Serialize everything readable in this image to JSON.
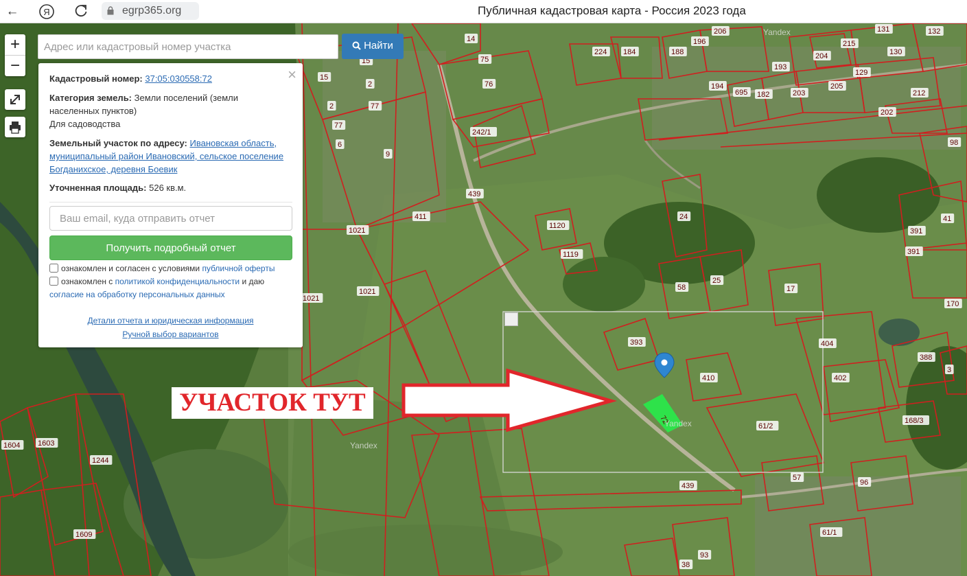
{
  "browser": {
    "url": "egrp365.org",
    "page_title": "Публичная кадастровая карта - Россия 2023 года",
    "icons": [
      "back-icon",
      "yandex-icon",
      "reload-icon",
      "lock-icon"
    ]
  },
  "map_controls": {
    "zoom_in": "+",
    "zoom_out": "−"
  },
  "search": {
    "placeholder": "Адрес или кадастровый номер участка",
    "button_label": "Найти"
  },
  "info_panel": {
    "cadastral_label": "Кадастровый номер:",
    "cadastral_value": "37:05:030558:72",
    "category_label": "Категория земель:",
    "category_value": "Земли поселений (земли населенных пунктов)",
    "usage": "Для садоводства",
    "address_label": "Земельный участок по адресу:",
    "address_value": "Ивановская область, муниципальный район Ивановский, сельское поселение Богданихское, деревня Боевик",
    "area_label": "Уточненная площадь:",
    "area_value": "526 кв.м.",
    "email_placeholder": "Ваш email, куда отправить отчет",
    "report_button": "Получить подробный отчет",
    "consent1_text": "ознакомлен и согласен с условиями",
    "consent1_link": "публичной оферты",
    "consent2_text1": "ознакомлен с",
    "consent2_link1": "политикой конфиденциальности",
    "consent2_text2": "и даю",
    "consent2_link2": "согласие на обработку персональных данных",
    "details_link": "Детали отчета и юридическая информация",
    "manual_link": "Ручной выбор вариантов",
    "close": "×"
  },
  "annotation": {
    "label": "УЧАСТОК ТУТ"
  },
  "watermarks": [
    "Yandex",
    "Yandex",
    "Yandex"
  ],
  "plot_labels": [
    "14",
    "75",
    "76",
    "15",
    "2",
    "77",
    "2",
    "77",
    "6",
    "9",
    "15",
    "242/1",
    "439",
    "411",
    "1021",
    "1021",
    "1021",
    "224",
    "184",
    "188",
    "196",
    "206",
    "131",
    "132",
    "215",
    "130",
    "194",
    "695",
    "182",
    "203",
    "193",
    "129",
    "204",
    "205",
    "212",
    "202",
    "98",
    "24",
    "1120",
    "1119",
    "58",
    "25",
    "17",
    "393",
    "410",
    "404",
    "402",
    "61/2",
    "391",
    "391",
    "41",
    "388",
    "3",
    "168/3",
    "57",
    "61/1",
    "96",
    "93",
    "38",
    "439",
    "1603",
    "1604",
    "1244",
    "1609",
    "170"
  ],
  "colors": {
    "boundary": "#d01f1f",
    "selected_plot": "#2ee24a",
    "marker": "#2e86d1",
    "button_blue": "#337ab7",
    "button_green": "#5cb85c"
  }
}
